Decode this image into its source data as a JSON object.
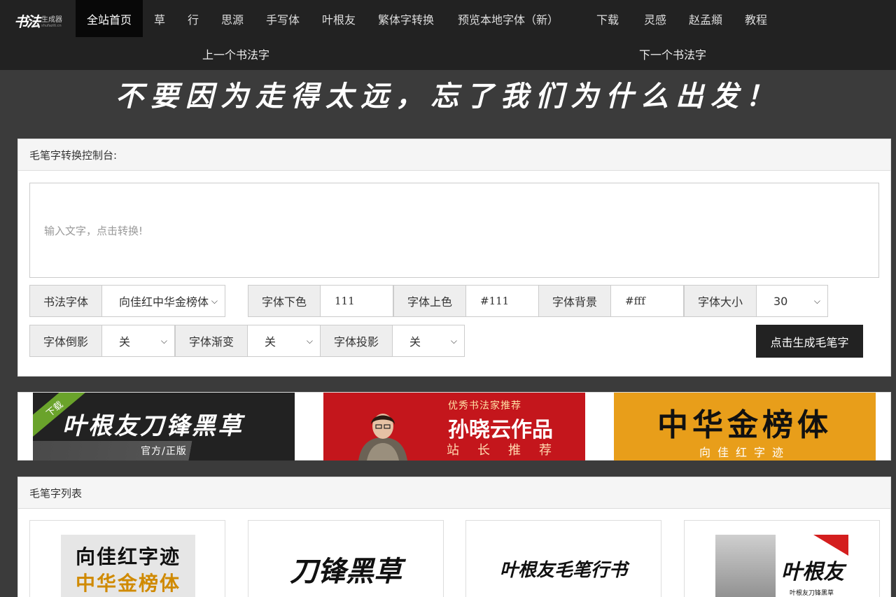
{
  "logo": {
    "main": "书法",
    "sub": "生成器",
    "url_text": "shufaziti.cn"
  },
  "nav": {
    "items": [
      "全站首页",
      "草",
      "行",
      "思源",
      "手写体",
      "叶根友",
      "繁体字转换",
      "预览本地字体（新）",
      "下载",
      "灵感",
      "赵孟頫",
      "教程"
    ],
    "prev": "上一个书法字",
    "next": "下一个书法字"
  },
  "slogan": "不要因为走得太远，忘了我们为什么出发！",
  "console": {
    "title": "毛笔字转换控制台:",
    "placeholder": "输入文字，点击转换!",
    "font_label": "书法字体",
    "font_value": "向佳红中华金榜体",
    "lower_color_label": "字体下色",
    "lower_color_value": "111",
    "upper_color_label": "字体上色",
    "upper_color_value": "#111",
    "bg_label": "字体背景",
    "bg_value": "#fff",
    "size_label": "字体大小",
    "size_value": "30",
    "reflect_label": "字体倒影",
    "reflect_value": "关",
    "gradient_label": "字体渐变",
    "gradient_value": "关",
    "shadow_label": "字体投影",
    "shadow_value": "关",
    "generate_button": "点击生成毛笔字"
  },
  "ads": {
    "ad1": {
      "ribbon": "下载",
      "title": "叶根友刀锋黑草",
      "footer": "官方/正版"
    },
    "ad2": {
      "top": "优秀书法家推荐",
      "title": "孙晓云作品",
      "bottom": "站长推荐"
    },
    "ad3": {
      "title": "中华金榜体",
      "sub": "向佳红字迹"
    }
  },
  "list": {
    "title": "毛笔字列表",
    "cards": [
      {
        "line1": "向佳红字迹",
        "line2": "中华金榜体"
      },
      {
        "text": "刀锋黑草"
      },
      {
        "text": "叶根友毛笔行书"
      },
      {
        "name": "叶根友",
        "sub": "叶根友刀锋黑草"
      }
    ]
  }
}
